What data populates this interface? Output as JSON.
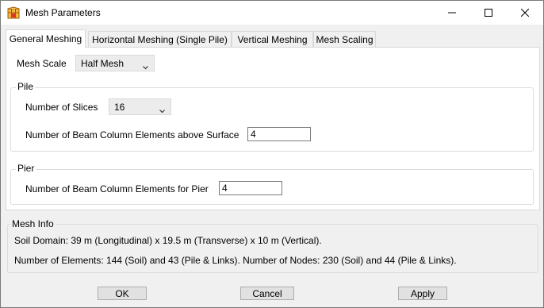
{
  "window": {
    "title": "Mesh Parameters"
  },
  "tabs": [
    {
      "label": "General Meshing"
    },
    {
      "label": "Horizontal Meshing (Single Pile)"
    },
    {
      "label": "Vertical Meshing"
    },
    {
      "label": "Mesh Scaling"
    }
  ],
  "general": {
    "mesh_scale_label": "Mesh Scale",
    "mesh_scale_value": "Half Mesh",
    "pile": {
      "title": "Pile",
      "slices_label": "Number of Slices",
      "slices_value": "16",
      "beam_elements_label": "Number of Beam Column Elements above Surface",
      "beam_elements_value": "4"
    },
    "pier": {
      "title": "Pier",
      "beam_elements_label": "Number of Beam Column Elements for Pier",
      "beam_elements_value": "4"
    }
  },
  "mesh_info": {
    "title": "Mesh Info",
    "soil_domain": "Soil Domain: 39 m (Longitudinal) x 19.5 m (Transverse) x 10 m (Vertical).",
    "counts": "Number of Elements: 144 (Soil) and 43 (Pile & Links). Number of Nodes: 230 (Soil) and 44 (Pile & Links)."
  },
  "buttons": {
    "ok": "OK",
    "cancel": "Cancel",
    "apply": "Apply"
  },
  "icons": {
    "app": "mesh-app-icon",
    "minimize": "minimize-icon",
    "maximize": "maximize-icon",
    "close": "close-icon",
    "dropdown": "chevron-down-icon"
  },
  "colors": {
    "app_icon": "#e8a020"
  }
}
